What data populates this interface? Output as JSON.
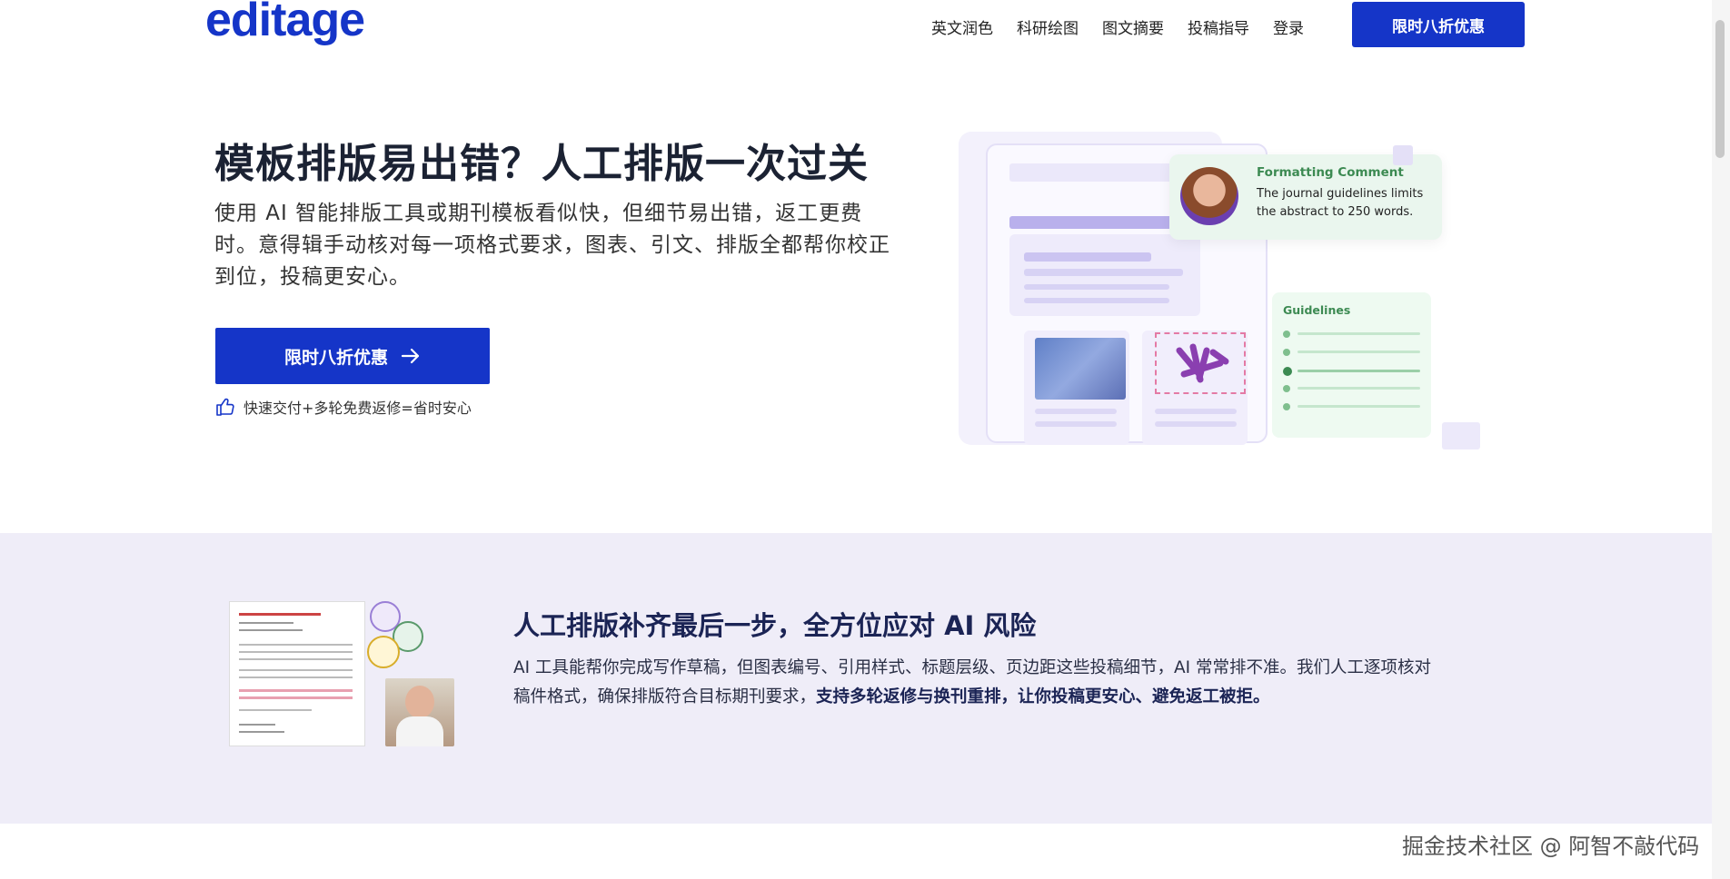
{
  "header": {
    "logo": "editage",
    "nav": [
      "英文润色",
      "科研绘图",
      "图文摘要",
      "投稿指导",
      "登录"
    ],
    "cta": "限时八折优惠"
  },
  "hero": {
    "title": "模板排版易出错？人工排版一次过关",
    "description": "使用 AI 智能排版工具或期刊模板看似快，但细节易出错，返工更费时。意得辑手动核对每一项格式要求，图表、引文、排版全都帮你校正到位，投稿更安心。",
    "cta": "限时八折优惠",
    "note": "快速交付+多轮免费返修=省时安心"
  },
  "illustration": {
    "comment_title": "Formatting Comment",
    "comment_body": "The journal guidelines limits the abstract to 250 words.",
    "guidelines_title": "Guidelines"
  },
  "band": {
    "title": "人工排版补齐最后一步，全方位应对 AI 风险",
    "desc_plain": "AI 工具能帮你完成写作草稿，但图表编号、引用样式、标题层级、页边距这些投稿细节，AI 常常排不准。我们人工逐项核对稿件格式，确保排版符合目标期刊要求，",
    "desc_bold": "支持多轮返修与换刊重排，让你投稿更安心、避免返工被拒。"
  },
  "watermark": "掘金技术社区 @ 阿智不敲代码",
  "colors": {
    "brand": "#1535c8",
    "band_bg": "#efedf8",
    "lavender": "#d9d3f5",
    "green": "#3c8a52"
  }
}
